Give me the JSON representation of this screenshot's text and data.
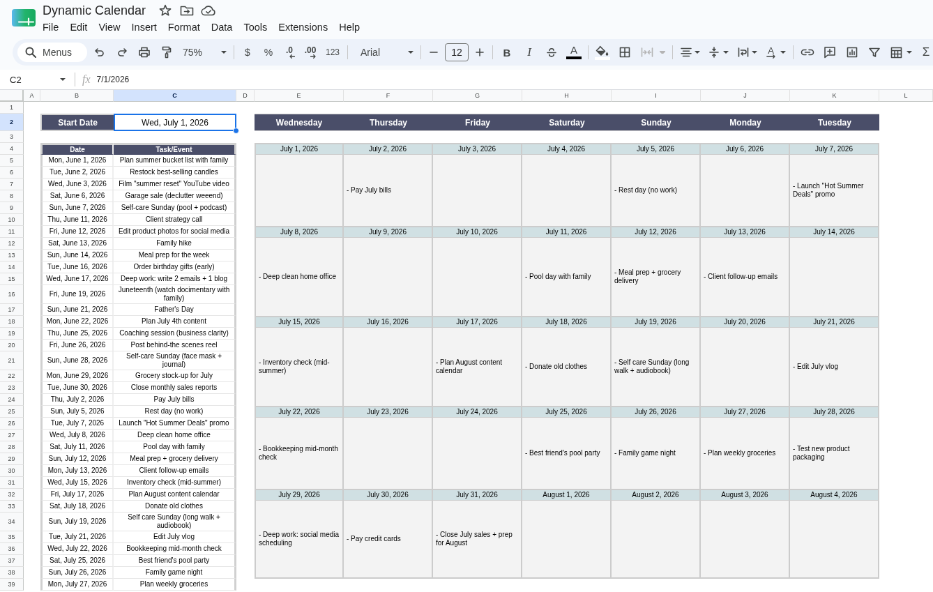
{
  "document": {
    "title": "Dynamic Calendar",
    "menu": [
      "File",
      "Edit",
      "View",
      "Insert",
      "Format",
      "Data",
      "Tools",
      "Extensions",
      "Help"
    ]
  },
  "toolbar": {
    "search": {
      "placeholder": "Menus"
    },
    "zoom": "75%",
    "currency": "$",
    "percent": "%",
    "decrease_decimal": ".0",
    "increase_decimal": ".00",
    "number_format": "123",
    "font": "Arial",
    "font_size": "12",
    "bold": "B",
    "italic": "I",
    "text_color": "A",
    "merge": {
      "disabled": true
    },
    "text_rotation": "A",
    "functions": "Σ"
  },
  "formula_bar": {
    "cell": "C2",
    "fx": "fx",
    "value": "7/1/2026"
  },
  "sheet": {
    "columns": [
      {
        "label": "A",
        "selected": false
      },
      {
        "label": "B",
        "selected": false
      },
      {
        "label": "C",
        "selected": true
      },
      {
        "label": "D",
        "selected": false
      },
      {
        "label": "E",
        "selected": false
      },
      {
        "label": "F",
        "selected": false
      },
      {
        "label": "G",
        "selected": false
      },
      {
        "label": "H",
        "selected": false
      },
      {
        "label": "I",
        "selected": false
      },
      {
        "label": "J",
        "selected": false
      },
      {
        "label": "K",
        "selected": false
      },
      {
        "label": "L",
        "selected": false
      }
    ],
    "rows": [
      {
        "label": "1",
        "selected": false
      },
      {
        "label": "2",
        "selected": true
      },
      {
        "label": "3",
        "selected": false
      },
      {
        "label": "4",
        "selected": false
      },
      {
        "label": "5",
        "selected": false
      },
      {
        "label": "6",
        "selected": false
      },
      {
        "label": "7",
        "selected": false
      },
      {
        "label": "8",
        "selected": false
      },
      {
        "label": "9",
        "selected": false
      },
      {
        "label": "10",
        "selected": false
      },
      {
        "label": "11",
        "selected": false
      },
      {
        "label": "12",
        "selected": false
      },
      {
        "label": "13",
        "selected": false
      },
      {
        "label": "14",
        "selected": false
      },
      {
        "label": "15",
        "selected": false
      },
      {
        "label": "16",
        "selected": false
      },
      {
        "label": "17",
        "selected": false
      },
      {
        "label": "18",
        "selected": false
      },
      {
        "label": "19",
        "selected": false
      },
      {
        "label": "20",
        "selected": false
      },
      {
        "label": "21",
        "selected": false
      },
      {
        "label": "22",
        "selected": false
      },
      {
        "label": "23",
        "selected": false
      },
      {
        "label": "24",
        "selected": false
      },
      {
        "label": "25",
        "selected": false
      },
      {
        "label": "26",
        "selected": false
      },
      {
        "label": "27",
        "selected": false
      },
      {
        "label": "28",
        "selected": false
      },
      {
        "label": "29",
        "selected": false
      },
      {
        "label": "30",
        "selected": false
      },
      {
        "label": "31",
        "selected": false
      },
      {
        "label": "32",
        "selected": false
      },
      {
        "label": "33",
        "selected": false
      },
      {
        "label": "34",
        "selected": false
      },
      {
        "label": "35",
        "selected": false
      },
      {
        "label": "36",
        "selected": false
      },
      {
        "label": "37",
        "selected": false
      },
      {
        "label": "38",
        "selected": false
      },
      {
        "label": "39",
        "selected": false
      }
    ],
    "start_date": {
      "label": "Start Date",
      "value": "Wed, July 1, 2026",
      "selected": true
    },
    "weekdays": [
      "Wednesday",
      "Thursday",
      "Friday",
      "Saturday",
      "Sunday",
      "Monday",
      "Tuesday"
    ],
    "task_table": {
      "columns": [
        "Date",
        "Task/Event"
      ],
      "rows": [
        {
          "date": "Mon, June 1, 2026",
          "task": "Plan summer bucket list with family"
        },
        {
          "date": "Tue, June 2, 2026",
          "task": "Restock best-selling candles"
        },
        {
          "date": "Wed, June 3, 2026",
          "task": "Film \"summer reset\" YouTube video"
        },
        {
          "date": "Sat, June 6, 2026",
          "task": "Garage sale (declutter weeend)"
        },
        {
          "date": "Sun, June 7, 2026",
          "task": "Self-care Sunday (pool + podcast)"
        },
        {
          "date": "Thu, June 11, 2026",
          "task": "Client strategy call"
        },
        {
          "date": "Fri, June 12, 2026",
          "task": "Edit product photos for social media"
        },
        {
          "date": "Sat, June 13, 2026",
          "task": "Family hike"
        },
        {
          "date": "Sun, June 14, 2026",
          "task": "Meal prep for the week"
        },
        {
          "date": "Tue, June 16, 2026",
          "task": "Order birthday gifts (early)"
        },
        {
          "date": "Wed, June 17, 2026",
          "task": "Deep work: write 2 emails + 1 blog"
        },
        {
          "date": "Fri, June 19, 2026",
          "task": "Juneteenth (watch docimentary with family)"
        },
        {
          "date": "Sun, June 21, 2026",
          "task": "Father's Day"
        },
        {
          "date": "Mon, June 22, 2026",
          "task": "Plan July 4th content"
        },
        {
          "date": "Thu, June 25, 2026",
          "task": "Coaching session (business clarity)"
        },
        {
          "date": "Fri, June 26, 2026",
          "task": "Post behind-the scenes reel"
        },
        {
          "date": "Sun, June 28, 2026",
          "task": "Self-care Sunday (face mask + journal)"
        },
        {
          "date": "Mon, June 29, 2026",
          "task": "Grocery stock-up for July"
        },
        {
          "date": "Tue, June 30, 2026",
          "task": "Close monthly sales reports"
        },
        {
          "date": "Thu, July 2, 2026",
          "task": "Pay July bills"
        },
        {
          "date": "Sun, July 5, 2026",
          "task": "Rest day (no work)"
        },
        {
          "date": "Tue, July 7, 2026",
          "task": "Launch \"Hot Summer Deals\" promo"
        },
        {
          "date": "Wed, July 8, 2026",
          "task": "Deep clean home office"
        },
        {
          "date": "Sat, July 11, 2026",
          "task": "Pool day with family"
        },
        {
          "date": "Sun, July 12, 2026",
          "task": "Meal prep + grocery delivery"
        },
        {
          "date": "Mon, July 13, 2026",
          "task": "Client follow-up emails"
        },
        {
          "date": "Wed, July 15, 2026",
          "task": "Inventory check (mid-summer)"
        },
        {
          "date": "Fri, July 17, 2026",
          "task": "Plan August content calendar"
        },
        {
          "date": "Sat, July 18, 2026",
          "task": "Donate old clothes"
        },
        {
          "date": "Sun, July 19, 2026",
          "task": "Self care Sunday (long walk + audiobook)"
        },
        {
          "date": "Tue, July 21, 2026",
          "task": "Edit July vlog"
        },
        {
          "date": "Wed, July 22, 2026",
          "task": "Bookkeeping mid-month check"
        },
        {
          "date": "Sat, July 25, 2026",
          "task": "Best friend's pool party"
        },
        {
          "date": "Sun, July 26, 2026",
          "task": "Family game night"
        },
        {
          "date": "Mon, July 27, 2026",
          "task": "Plan weekly groceries"
        }
      ]
    },
    "calendar_weeks": [
      {
        "days": [
          {
            "date": "July 1, 2026"
          },
          {
            "date": "July 2, 2026",
            "event": "- Pay July bills"
          },
          {
            "date": "July 3, 2026"
          },
          {
            "date": "July 4, 2026"
          },
          {
            "date": "July 5, 2026",
            "event": "- Rest day (no work)"
          },
          {
            "date": "July 6, 2026"
          },
          {
            "date": "July 7, 2026",
            "event": "- Launch \"Hot Summer Deals\" promo"
          }
        ]
      },
      {
        "days": [
          {
            "date": "July 8, 2026",
            "event": "- Deep clean home office"
          },
          {
            "date": "July 9, 2026"
          },
          {
            "date": "July 10, 2026"
          },
          {
            "date": "July 11, 2026",
            "event": "- Pool day with family"
          },
          {
            "date": "July 12, 2026",
            "event": "- Meal prep + grocery delivery"
          },
          {
            "date": "July 13, 2026",
            "event": "- Client follow-up emails"
          },
          {
            "date": "July 14, 2026"
          }
        ]
      },
      {
        "days": [
          {
            "date": "July 15, 2026",
            "event": "- Inventory check (mid-summer)"
          },
          {
            "date": "July 16, 2026"
          },
          {
            "date": "July 17, 2026",
            "event": "- Plan August content calendar"
          },
          {
            "date": "July 18, 2026",
            "event": "- Donate old clothes"
          },
          {
            "date": "July 19, 2026",
            "event": "- Self care Sunday (long walk + audiobook)"
          },
          {
            "date": "July 20, 2026"
          },
          {
            "date": "July 21, 2026",
            "event": "- Edit July vlog"
          }
        ]
      },
      {
        "days": [
          {
            "date": "July 22, 2026",
            "event": "- Bookkeeping mid-month check"
          },
          {
            "date": "July 23, 2026"
          },
          {
            "date": "July 24, 2026"
          },
          {
            "date": "July 25, 2026",
            "event": "- Best friend's pool party"
          },
          {
            "date": "July 26, 2026",
            "event": "- Family game night"
          },
          {
            "date": "July 27, 2026",
            "event": "- Plan weekly groceries"
          },
          {
            "date": "July 28, 2026",
            "event": "- Test new product packaging"
          }
        ]
      },
      {
        "days": [
          {
            "date": "July 29, 2026",
            "event": "- Deep work: social media scheduling"
          },
          {
            "date": "July 30, 2026",
            "event": "- Pay credit cards"
          },
          {
            "date": "July 31, 2026",
            "event": "- Close July sales + prep for August"
          },
          {
            "date": "August 1, 2026"
          },
          {
            "date": "August 2, 2026"
          },
          {
            "date": "August 3, 2026"
          },
          {
            "date": "August 4, 2026"
          }
        ]
      }
    ]
  }
}
